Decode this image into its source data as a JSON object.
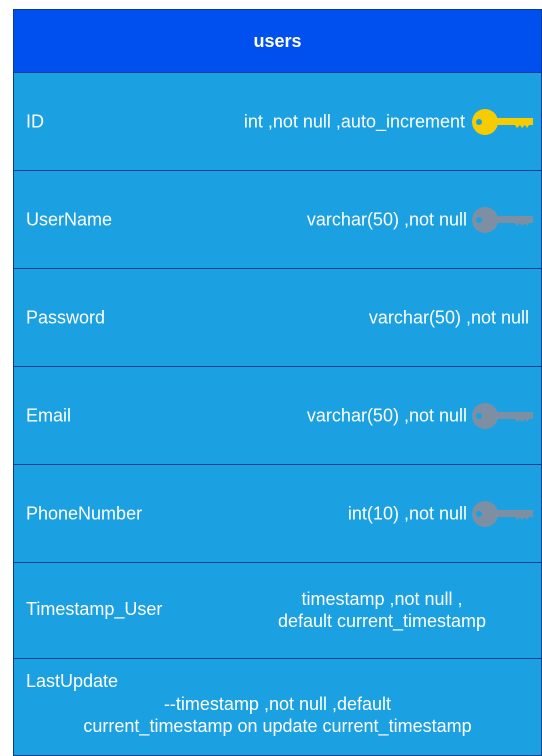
{
  "table": {
    "title": "users",
    "colors": {
      "header": "#0050ef",
      "body": "#1ba1e2",
      "border": "#0a3d8f",
      "primary_key": "#f4cc00",
      "secondary_key": "#7e8fa3"
    },
    "rows": [
      {
        "name": "ID",
        "type": "int ,not null ,auto_increment",
        "icon": "primary-key-icon"
      },
      {
        "name": "UserName",
        "type": "varchar(50) ,not null",
        "icon": "key-icon"
      },
      {
        "name": "Password",
        "type": "varchar(50) ,not null",
        "icon": ""
      },
      {
        "name": "Email",
        "type": "varchar(50) ,not null",
        "icon": "key-icon"
      },
      {
        "name": "PhoneNumber",
        "type": "int(10) ,not null",
        "icon": "key-icon"
      },
      {
        "name": "Timestamp_User",
        "type_line1": "timestamp ,not null ,",
        "type_line2": "default current_timestamp"
      },
      {
        "name": "LastUpdate",
        "type_line1": "--timestamp ,not null ,default",
        "type_line2": "current_timestamp on update current_timestamp"
      }
    ]
  }
}
